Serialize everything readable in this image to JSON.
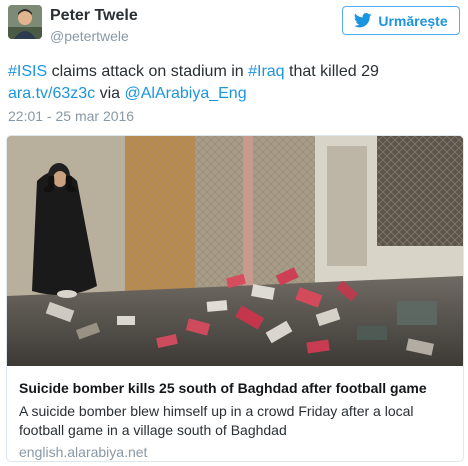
{
  "user": {
    "name": "Peter Twele",
    "handle": "@petertwele"
  },
  "follow_button": {
    "label": "Urmărește",
    "icon": "twitter-bird-icon"
  },
  "tweet": {
    "segments": [
      {
        "text": "#ISIS",
        "link": true
      },
      {
        "text": " claims attack on stadium in ",
        "link": false
      },
      {
        "text": "#Iraq",
        "link": true
      },
      {
        "text": " that killed 29 ",
        "link": false
      },
      {
        "text": "ara.tv/63z3c",
        "link": true
      },
      {
        "text": " via ",
        "link": false
      },
      {
        "text": "@AlArabiya_Eng",
        "link": true
      }
    ],
    "timestamp": "22:01 - 25 mar 2016"
  },
  "card": {
    "image_subject": "stadium-attack-aftermath-photo",
    "title": "Suicide bomber kills 25 south of Baghdad after football game",
    "description": "A suicide bomber blew himself up in a crowd Friday after a local football game in a village south of Baghdad",
    "domain": "english.alarabiya.net"
  },
  "colors": {
    "link": "#1b95e0",
    "muted": "#8899a6",
    "text": "#292f33",
    "border": "#e1e8ed"
  }
}
